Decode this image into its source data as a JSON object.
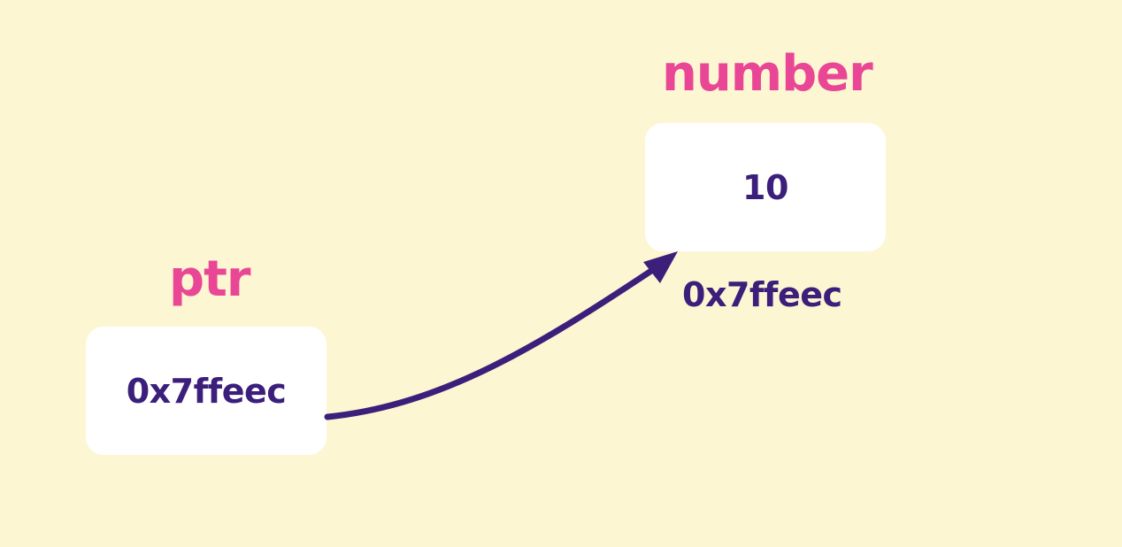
{
  "diagram": {
    "pointer": {
      "name": "ptr",
      "value": "0x7ffeec"
    },
    "target": {
      "name": "number",
      "value": "10",
      "address": "0x7ffeec"
    },
    "colors": {
      "background": "#fdf6d3",
      "variable_name": "#e94796",
      "text": "#3b1f7a",
      "box": "#ffffff",
      "arrow": "#3b1f7a"
    },
    "arrow": {
      "from": "ptr",
      "to": "number"
    }
  }
}
